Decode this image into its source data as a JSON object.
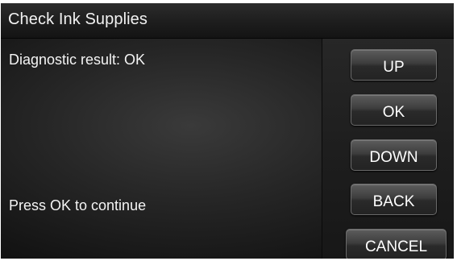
{
  "title_bar": {
    "title": "Check Ink Supplies"
  },
  "content": {
    "result_text": "Diagnostic result: OK",
    "instruction_text": "Press OK to continue"
  },
  "buttons": {
    "up": "UP",
    "ok": "OK",
    "down": "DOWN",
    "back": "BACK",
    "cancel": "CANCEL"
  }
}
